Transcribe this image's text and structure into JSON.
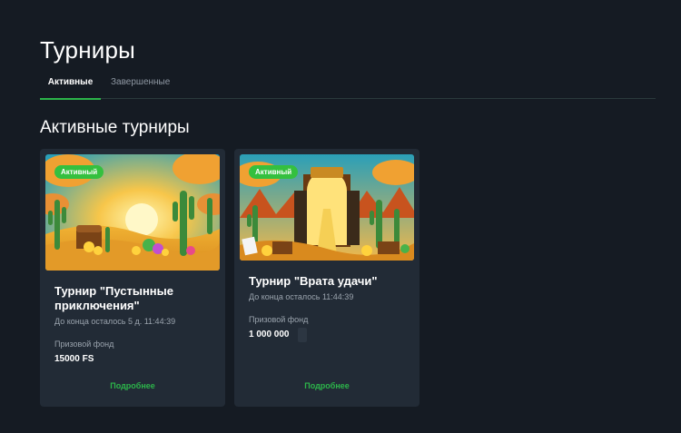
{
  "page": {
    "title": "Турниры"
  },
  "tabs": [
    {
      "label": "Активные",
      "active": true
    },
    {
      "label": "Завершенные",
      "active": false
    }
  ],
  "section": {
    "title": "Активные турниры"
  },
  "cards": [
    {
      "badge": "Активный",
      "title": "Турнир \"Пустынные приключения\"",
      "countdown": "До конца осталось 5 д. 11:44:39",
      "prize_label": "Призовой фонд",
      "prize_value": "15000 FS",
      "more_label": "Подробнее"
    },
    {
      "badge": "Активный",
      "title": "Турнир \"Врата удачи\"",
      "countdown": "До конца осталось 11:44:39",
      "prize_label": "Призовой фонд",
      "prize_value": "1 000 000",
      "more_label": "Подробнее"
    }
  ],
  "colors": {
    "background": "#151b23",
    "card": "#222b36",
    "accent": "#2cb44a",
    "muted": "#9aa3ad"
  }
}
